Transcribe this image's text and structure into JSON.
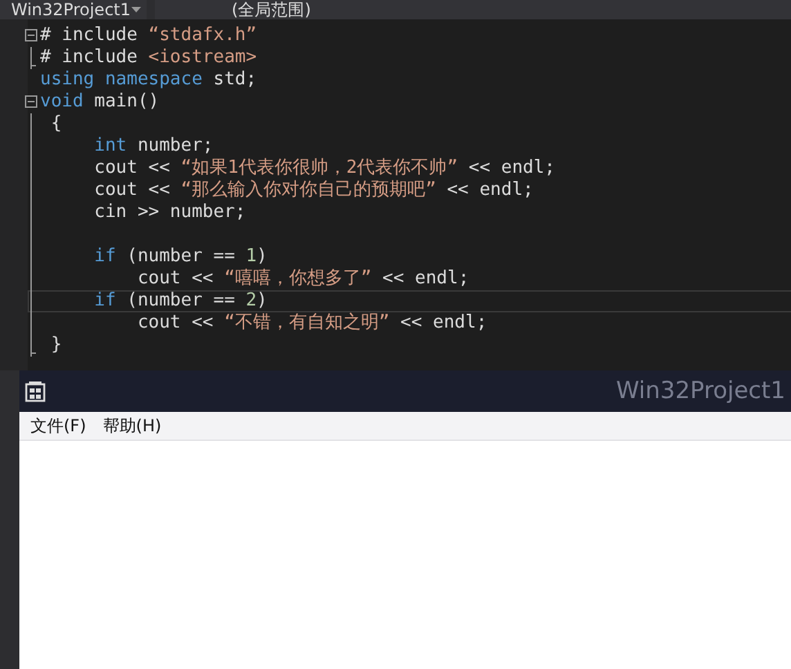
{
  "editor_bar": {
    "dropdowns": [
      {
        "label": "Win32Project1"
      },
      {
        "label": "(全局范围)"
      }
    ]
  },
  "code": {
    "lines": [
      {
        "collapsible": true,
        "in_block": false,
        "current": false,
        "tokens": [
          {
            "kind": "plain",
            "text": "# include "
          },
          {
            "kind": "string",
            "text": "“stdafx.h”"
          }
        ]
      },
      {
        "collapsible": false,
        "in_block": true,
        "current": false,
        "tokens": [
          {
            "kind": "plain",
            "text": "# include "
          },
          {
            "kind": "string",
            "text": "<iostream>"
          }
        ]
      },
      {
        "collapsible": false,
        "in_block": false,
        "current": false,
        "tokens": [
          {
            "kind": "keyword",
            "text": "using"
          },
          {
            "kind": "keyword",
            "text": " namespace"
          },
          {
            "kind": "plain",
            "text": " std;"
          }
        ]
      },
      {
        "collapsible": true,
        "in_block": false,
        "current": false,
        "tokens": [
          {
            "kind": "keyword",
            "text": "void"
          },
          {
            "kind": "plain",
            "text": " main()"
          }
        ]
      },
      {
        "collapsible": false,
        "in_block": true,
        "current": false,
        "tokens": [
          {
            "kind": "plain",
            "text": " {"
          }
        ]
      },
      {
        "collapsible": false,
        "in_block": true,
        "current": false,
        "tokens": [
          {
            "kind": "keyword",
            "text": "     int"
          },
          {
            "kind": "plain",
            "text": " number;"
          }
        ]
      },
      {
        "collapsible": false,
        "in_block": true,
        "current": false,
        "tokens": [
          {
            "kind": "plain",
            "text": "     cout << "
          },
          {
            "kind": "string",
            "text": "“如果1代表你很帅，2代表你不帅”"
          },
          {
            "kind": "plain",
            "text": " << endl;"
          }
        ]
      },
      {
        "collapsible": false,
        "in_block": true,
        "current": false,
        "tokens": [
          {
            "kind": "plain",
            "text": "     cout << "
          },
          {
            "kind": "string",
            "text": "“那么输入你对你自己的预期吧”"
          },
          {
            "kind": "plain",
            "text": " << endl;"
          }
        ]
      },
      {
        "collapsible": false,
        "in_block": true,
        "current": false,
        "tokens": [
          {
            "kind": "plain",
            "text": "     cin >> number;"
          }
        ]
      },
      {
        "collapsible": false,
        "in_block": true,
        "current": false
      },
      {
        "collapsible": false,
        "in_block": true,
        "current": false,
        "tokens": [
          {
            "kind": "keyword",
            "text": "     if"
          },
          {
            "kind": "plain",
            "text": " (number == "
          },
          {
            "kind": "number",
            "text": "1"
          },
          {
            "kind": "plain",
            "text": ")"
          }
        ]
      },
      {
        "collapsible": false,
        "in_block": true,
        "current": false,
        "tokens": [
          {
            "kind": "plain",
            "text": "         cout << "
          },
          {
            "kind": "string",
            "text": "“嘻嘻，你想多了”"
          },
          {
            "kind": "plain",
            "text": " << endl;"
          }
        ]
      },
      {
        "collapsible": false,
        "in_block": true,
        "current": true,
        "tokens": [
          {
            "kind": "keyword",
            "text": "     if"
          },
          {
            "kind": "plain",
            "text": " (number == "
          },
          {
            "kind": "number",
            "text": "2"
          },
          {
            "kind": "plain",
            "text": ")"
          }
        ]
      },
      {
        "collapsible": false,
        "in_block": true,
        "current": false,
        "tokens": [
          {
            "kind": "plain",
            "text": "         cout << "
          },
          {
            "kind": "string",
            "text": "“不错，有自知之明”"
          },
          {
            "kind": "plain",
            "text": " << endl;"
          }
        ]
      },
      {
        "collapsible": false,
        "in_block": true,
        "current": false,
        "tokens": [
          {
            "kind": "plain",
            "text": " }"
          }
        ]
      }
    ]
  },
  "app_window": {
    "title": "Win32Project1",
    "menu": [
      {
        "label": "文件(F)"
      },
      {
        "label": "帮助(H)"
      }
    ]
  }
}
